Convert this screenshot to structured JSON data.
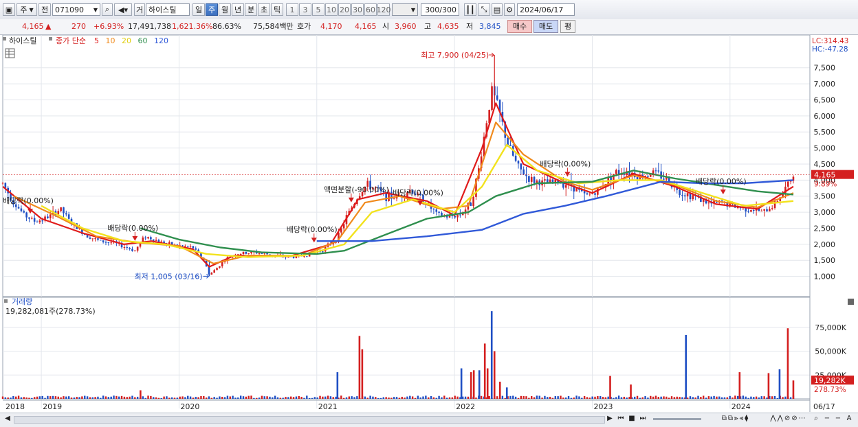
{
  "toolbar": {
    "period_select": "주",
    "prev_label": "전",
    "code": "071090",
    "mode_label": "거",
    "stock_name": "하이스틸",
    "period_tabs": [
      "일",
      "주",
      "월",
      "년",
      "분",
      "초",
      "틱"
    ],
    "active_tab": 1,
    "intervals": [
      "1",
      "3",
      "5",
      "10",
      "20",
      "30",
      "60",
      "120"
    ],
    "count": "300",
    "count_total": "/300",
    "date": "2024/06/17"
  },
  "info": {
    "price": "4,165",
    "change": "270",
    "change_pct": "+6.93%",
    "volume": "17,491,738",
    "volume_pct": "1,621.36%",
    "turnover_pct": "86.63%",
    "amount": "75,584백만",
    "bid_label": "호가",
    "bid1": "4,170",
    "bid2": "4,165",
    "open_label": "시",
    "open": "3,960",
    "high_label": "고",
    "high": "4,635",
    "low_label": "저",
    "low": "3,845",
    "buy_label": "매수",
    "sell_label": "매도",
    "avg_label": "평"
  },
  "legend": {
    "stock": "하이스틸",
    "prefix": "종가 단순",
    "ma_periods": [
      "5",
      "10",
      "20",
      "60",
      "120"
    ],
    "lc": "LC:314.43",
    "hc": "HC:-47.28",
    "volume_title": "거래량",
    "volume_value": "19,282,081주(278.73%)"
  },
  "colors": {
    "up": "#d41f1f",
    "down": "#1f4fc4",
    "ma5": "#e01a1a",
    "ma10": "#f08a1c",
    "ma20": "#f2e21d",
    "ma60": "#2f8f4e",
    "ma120": "#3059d8"
  },
  "chart_data": {
    "type": "line",
    "series_type": "candlestick + moving averages",
    "y_axis": {
      "ticks": [
        1000,
        1500,
        2000,
        2500,
        3000,
        3500,
        4000,
        4500,
        5000,
        5500,
        6000,
        6500,
        7000,
        7500
      ],
      "tick_labels": [
        "1,000",
        "1,500",
        "2,000",
        "2,500",
        "3,000",
        "3,500",
        "4,000",
        "4,500",
        "5,000",
        "5,500",
        "6,000",
        "6,500",
        "7,000",
        "7,500"
      ],
      "range": [
        500,
        8200
      ]
    },
    "x_axis": {
      "labels": [
        "2018",
        "2019",
        "2020",
        "2021",
        "2022",
        "2023",
        "2024",
        "06/17"
      ],
      "years": [
        2018.85,
        2019.0,
        2020.0,
        2021.0,
        2022.0,
        2023.0,
        2024.0,
        2024.46
      ],
      "range": [
        2018.72,
        2024.58
      ]
    },
    "current_price": 4165,
    "current_price_label": "4,165",
    "current_pct_label": "9.89%",
    "close_points": [
      [
        2018.72,
        3900
      ],
      [
        2018.8,
        3300
      ],
      [
        2018.88,
        2900
      ],
      [
        2018.96,
        2700
      ],
      [
        2019.05,
        2850
      ],
      [
        2019.14,
        3100
      ],
      [
        2019.22,
        2650
      ],
      [
        2019.32,
        2300
      ],
      [
        2019.42,
        2100
      ],
      [
        2019.52,
        2050
      ],
      [
        2019.62,
        1900
      ],
      [
        2019.68,
        1800
      ],
      [
        2019.75,
        2250
      ],
      [
        2019.82,
        2150
      ],
      [
        2019.92,
        2000
      ],
      [
        2020.0,
        1950
      ],
      [
        2020.1,
        1900
      ],
      [
        2020.18,
        1500
      ],
      [
        2020.22,
        1050
      ],
      [
        2020.26,
        1200
      ],
      [
        2020.34,
        1550
      ],
      [
        2020.42,
        1700
      ],
      [
        2020.55,
        1750
      ],
      [
        2020.7,
        1650
      ],
      [
        2020.85,
        1600
      ],
      [
        2020.95,
        1700
      ],
      [
        2021.05,
        1850
      ],
      [
        2021.15,
        2200
      ],
      [
        2021.22,
        2900
      ],
      [
        2021.3,
        3500
      ],
      [
        2021.36,
        3850
      ],
      [
        2021.42,
        3750
      ],
      [
        2021.5,
        3500
      ],
      [
        2021.58,
        3450
      ],
      [
        2021.68,
        3700
      ],
      [
        2021.78,
        3350
      ],
      [
        2021.88,
        2900
      ],
      [
        2021.96,
        2850
      ],
      [
        2022.05,
        2950
      ],
      [
        2022.12,
        3300
      ],
      [
        2022.17,
        4200
      ],
      [
        2022.22,
        5500
      ],
      [
        2022.27,
        6800
      ],
      [
        2022.32,
        6200
      ],
      [
        2022.38,
        5200
      ],
      [
        2022.46,
        4400
      ],
      [
        2022.55,
        4000
      ],
      [
        2022.65,
        3900
      ],
      [
        2022.75,
        3950
      ],
      [
        2022.85,
        3850
      ],
      [
        2022.95,
        3500
      ],
      [
        2023.05,
        3700
      ],
      [
        2023.15,
        4200
      ],
      [
        2023.25,
        4300
      ],
      [
        2023.35,
        4100
      ],
      [
        2023.45,
        4250
      ],
      [
        2023.55,
        4000
      ],
      [
        2023.65,
        3600
      ],
      [
        2023.75,
        3500
      ],
      [
        2023.85,
        3250
      ],
      [
        2023.95,
        3300
      ],
      [
        2024.05,
        3150
      ],
      [
        2024.15,
        3100
      ],
      [
        2024.25,
        3000
      ],
      [
        2024.32,
        3250
      ],
      [
        2024.38,
        3600
      ],
      [
        2024.42,
        3850
      ],
      [
        2024.46,
        4165
      ]
    ],
    "ma_series": [
      {
        "name": "5",
        "points": [
          [
            2018.72,
            3800
          ],
          [
            2019.0,
            2800
          ],
          [
            2019.3,
            2350
          ],
          [
            2019.6,
            2000
          ],
          [
            2019.8,
            2100
          ],
          [
            2020.1,
            1850
          ],
          [
            2020.22,
            1300
          ],
          [
            2020.4,
            1650
          ],
          [
            2020.8,
            1620
          ],
          [
            2021.1,
            2000
          ],
          [
            2021.3,
            3400
          ],
          [
            2021.5,
            3600
          ],
          [
            2021.8,
            3350
          ],
          [
            2022.0,
            2900
          ],
          [
            2022.2,
            5000
          ],
          [
            2022.3,
            6400
          ],
          [
            2022.5,
            4500
          ],
          [
            2022.8,
            3900
          ],
          [
            2023.0,
            3600
          ],
          [
            2023.3,
            4200
          ],
          [
            2023.6,
            3800
          ],
          [
            2023.9,
            3250
          ],
          [
            2024.2,
            3100
          ],
          [
            2024.46,
            3800
          ]
        ]
      },
      {
        "name": "10",
        "points": [
          [
            2018.8,
            3500
          ],
          [
            2019.1,
            2900
          ],
          [
            2019.4,
            2250
          ],
          [
            2019.7,
            2050
          ],
          [
            2020.0,
            1950
          ],
          [
            2020.25,
            1400
          ],
          [
            2020.5,
            1650
          ],
          [
            2020.9,
            1650
          ],
          [
            2021.15,
            2100
          ],
          [
            2021.35,
            3300
          ],
          [
            2021.6,
            3500
          ],
          [
            2021.9,
            3100
          ],
          [
            2022.1,
            3200
          ],
          [
            2022.3,
            5800
          ],
          [
            2022.5,
            4800
          ],
          [
            2022.8,
            3950
          ],
          [
            2023.0,
            3700
          ],
          [
            2023.3,
            4150
          ],
          [
            2023.6,
            3850
          ],
          [
            2023.9,
            3350
          ],
          [
            2024.2,
            3150
          ],
          [
            2024.46,
            3600
          ]
        ]
      },
      {
        "name": "20",
        "points": [
          [
            2019.0,
            3200
          ],
          [
            2019.3,
            2500
          ],
          [
            2019.6,
            2100
          ],
          [
            2019.9,
            2000
          ],
          [
            2020.2,
            1700
          ],
          [
            2020.5,
            1600
          ],
          [
            2020.9,
            1650
          ],
          [
            2021.2,
            2000
          ],
          [
            2021.4,
            3000
          ],
          [
            2021.7,
            3400
          ],
          [
            2022.0,
            3000
          ],
          [
            2022.2,
            3800
          ],
          [
            2022.38,
            5100
          ],
          [
            2022.6,
            4300
          ],
          [
            2022.9,
            3900
          ],
          [
            2023.2,
            4000
          ],
          [
            2023.5,
            4000
          ],
          [
            2023.8,
            3600
          ],
          [
            2024.1,
            3200
          ],
          [
            2024.46,
            3350
          ]
        ]
      },
      {
        "name": "60",
        "points": [
          [
            2019.72,
            2500
          ],
          [
            2020.0,
            2150
          ],
          [
            2020.3,
            1900
          ],
          [
            2020.6,
            1750
          ],
          [
            2021.0,
            1700
          ],
          [
            2021.2,
            1800
          ],
          [
            2021.5,
            2300
          ],
          [
            2021.8,
            2800
          ],
          [
            2022.1,
            3000
          ],
          [
            2022.3,
            3500
          ],
          [
            2022.6,
            3900
          ],
          [
            2023.0,
            3950
          ],
          [
            2023.3,
            4300
          ],
          [
            2023.6,
            4050
          ],
          [
            2023.9,
            3850
          ],
          [
            2024.2,
            3650
          ],
          [
            2024.46,
            3550
          ]
        ]
      },
      {
        "name": "120",
        "points": [
          [
            2021.0,
            2100
          ],
          [
            2021.4,
            2100
          ],
          [
            2021.8,
            2250
          ],
          [
            2022.2,
            2450
          ],
          [
            2022.5,
            2950
          ],
          [
            2022.8,
            3200
          ],
          [
            2023.1,
            3500
          ],
          [
            2023.5,
            3950
          ],
          [
            2023.8,
            3900
          ],
          [
            2024.1,
            3900
          ],
          [
            2024.46,
            4000
          ]
        ]
      }
    ],
    "annotations": [
      {
        "text": "배당락(0.00%)",
        "year": 2018.92,
        "price": 2850
      },
      {
        "text": "배당락(0.00%)",
        "year": 2019.68,
        "price": 2000
      },
      {
        "text": "배당락(0.00%)",
        "year": 2020.98,
        "price": 1950
      },
      {
        "text": "액면분할(-90.00%)",
        "year": 2021.25,
        "price": 3200
      },
      {
        "text": "배당락(0.00%)",
        "year": 2021.75,
        "price": 3100
      },
      {
        "text": "배당락(0.00%)",
        "year": 2022.82,
        "price": 4000
      },
      {
        "text": "배당락(0.00%)",
        "year": 2023.95,
        "price": 3450
      }
    ],
    "high_marker": {
      "text": "최고 7,900 (04/25)",
      "year": 2022.29,
      "price": 7900
    },
    "low_marker": {
      "text": "최저 1,005 (03/16)",
      "year": 2020.22,
      "price": 1005
    },
    "volume": {
      "tick_labels": [
        "25,000K",
        "50,000K",
        "75,000K"
      ],
      "ticks": [
        25000,
        50000,
        75000
      ],
      "max": 95000,
      "current_label": "19,282K",
      "current_pct": "278.73%",
      "spikes": [
        {
          "year": 2019.72,
          "value": 9000
        },
        {
          "year": 2021.15,
          "value": 28000
        },
        {
          "year": 2021.31,
          "value": 66000
        },
        {
          "year": 2021.33,
          "value": 52000
        },
        {
          "year": 2022.05,
          "value": 32000
        },
        {
          "year": 2022.12,
          "value": 28000
        },
        {
          "year": 2022.14,
          "value": 30000
        },
        {
          "year": 2022.18,
          "value": 30000
        },
        {
          "year": 2022.22,
          "value": 58000
        },
        {
          "year": 2022.24,
          "value": 32000
        },
        {
          "year": 2022.27,
          "value": 92000
        },
        {
          "year": 2022.29,
          "value": 50000
        },
        {
          "year": 2022.33,
          "value": 18000
        },
        {
          "year": 2022.38,
          "value": 12000
        },
        {
          "year": 2023.13,
          "value": 24000
        },
        {
          "year": 2023.28,
          "value": 15000
        },
        {
          "year": 2023.68,
          "value": 67000
        },
        {
          "year": 2024.07,
          "value": 28000
        },
        {
          "year": 2024.28,
          "value": 27000
        },
        {
          "year": 2024.36,
          "value": 31000
        },
        {
          "year": 2024.42,
          "value": 74000
        },
        {
          "year": 2024.46,
          "value": 19282
        }
      ]
    }
  }
}
